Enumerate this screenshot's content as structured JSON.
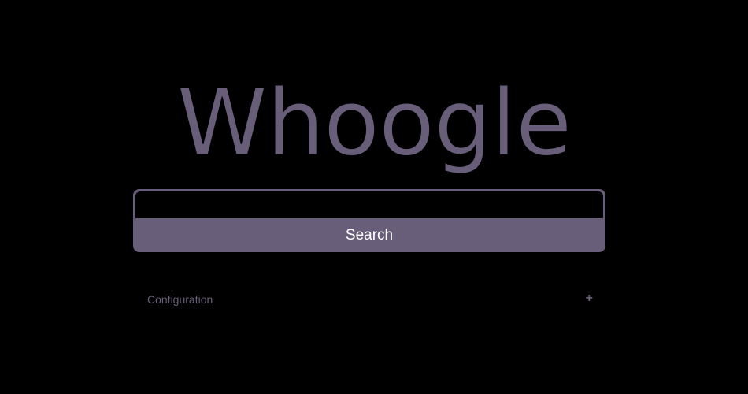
{
  "logo": {
    "text": "Whoogle"
  },
  "search": {
    "value": "",
    "placeholder": "",
    "button_label": "Search"
  },
  "config": {
    "label": "Configuration",
    "toggle_symbol": "+"
  },
  "colors": {
    "background": "#000000",
    "accent": "#685e79",
    "button_text": "#ffffff"
  }
}
